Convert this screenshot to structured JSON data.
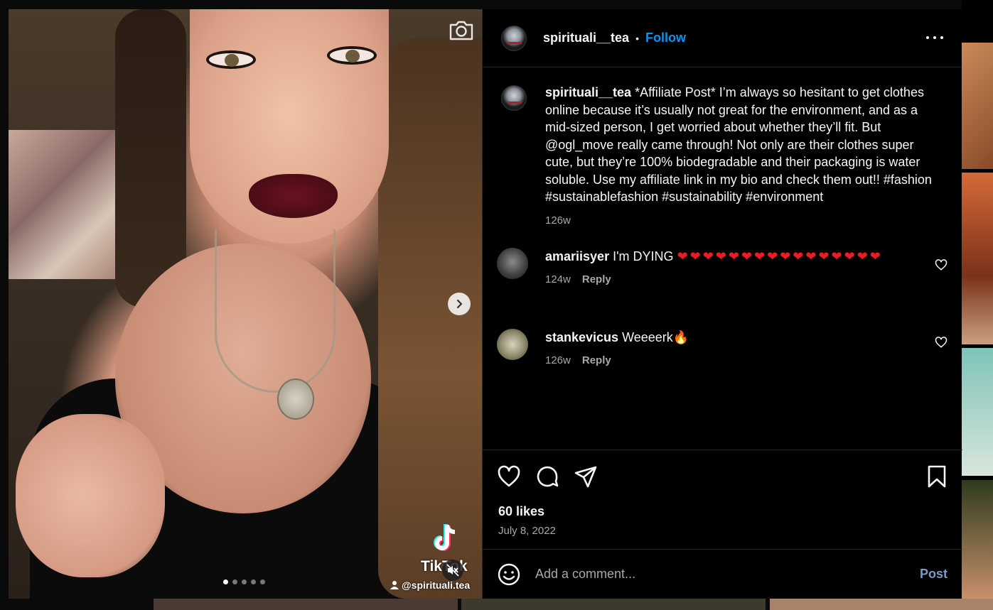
{
  "post": {
    "username": "spirituali__tea",
    "separator": "•",
    "follow_label": "Follow"
  },
  "media": {
    "tiktok_word": "TikTok",
    "tiktok_handle": "@spirituali.tea",
    "slide_count": 5,
    "active_slide": 1
  },
  "caption": {
    "username": "spirituali__tea",
    "text": "*Affiliate Post* I’m always so hesitant to get clothes online because it’s usually not great for the environment, and as a mid-sized person, I get worried about whether they’ll fit. But @ogl_move really came through! Not only are their clothes super cute, but they’re 100% biodegradable and their packaging is water soluble. Use my affiliate link in my bio and check them out!! #fashion #sustainablefashion #sustainability #environment",
    "time": "126w"
  },
  "comments": [
    {
      "username": "amariisyer",
      "text": "I'm DYING",
      "hearts": "❤❤❤❤❤❤❤❤❤❤❤❤❤❤❤❤",
      "time": "124w",
      "reply_label": "Reply"
    },
    {
      "username": "stankevicus",
      "text": "Weeeerk",
      "emoji": "🔥",
      "time": "126w",
      "reply_label": "Reply"
    }
  ],
  "stats": {
    "likes": "60 likes",
    "date": "July 8, 2022"
  },
  "composer": {
    "placeholder": "Add a comment...",
    "post_label": "Post"
  },
  "colors": {
    "accent": "#0095f6",
    "heart_red": "#ed1c24",
    "muted": "#a8a8a8"
  },
  "icons": [
    "camera-icon",
    "chevron-right-icon",
    "tiktok-icon",
    "mute-icon",
    "person-icon",
    "more-icon",
    "heart-icon",
    "comment-icon",
    "share-icon",
    "bookmark-icon",
    "emoji-icon"
  ]
}
